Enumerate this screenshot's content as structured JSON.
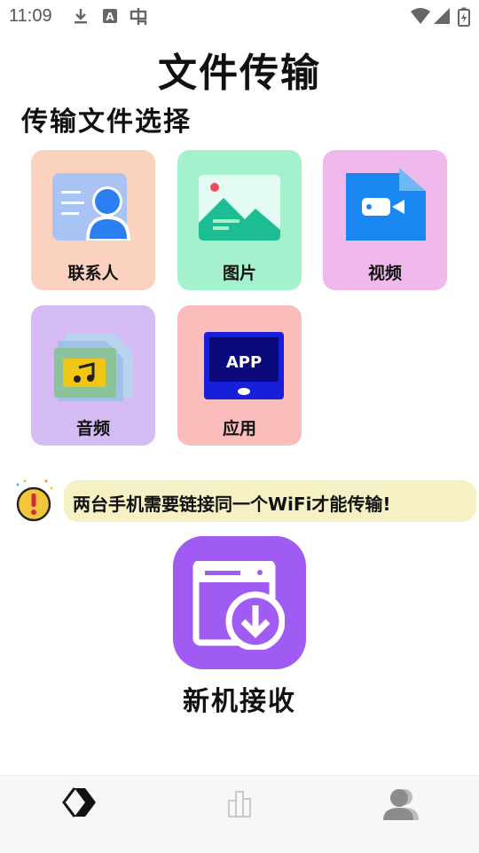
{
  "status_bar": {
    "time": "11:09",
    "icons": [
      "download-icon",
      "font-a-icon",
      "bug-icon",
      "wifi-icon",
      "signal-icon",
      "battery-charging-icon"
    ]
  },
  "page": {
    "title": "文件传输",
    "section_title": "传输文件选择"
  },
  "file_types": [
    {
      "label": "联系人",
      "icon": "contacts-icon",
      "bg": "#fbd1c0"
    },
    {
      "label": "图片",
      "icon": "image-icon",
      "bg": "#a3f1cd"
    },
    {
      "label": "视频",
      "icon": "video-icon",
      "bg": "#f0b9ec"
    },
    {
      "label": "音频",
      "icon": "audio-icon",
      "bg": "#d5bbf3"
    },
    {
      "label": "应用",
      "icon": "app-icon",
      "bg": "#fbbcbc"
    }
  ],
  "notice": {
    "icon": "warning-icon",
    "text": "两台手机需要链接同一个WiFi才能传输!"
  },
  "receive": {
    "icon": "download-box-icon",
    "label": "新机接收"
  },
  "bottom_nav": {
    "items": [
      {
        "icon": "transfer-icon",
        "active": true
      },
      {
        "icon": "chart-icon",
        "active": false
      },
      {
        "icon": "user-icon",
        "active": false
      }
    ]
  }
}
